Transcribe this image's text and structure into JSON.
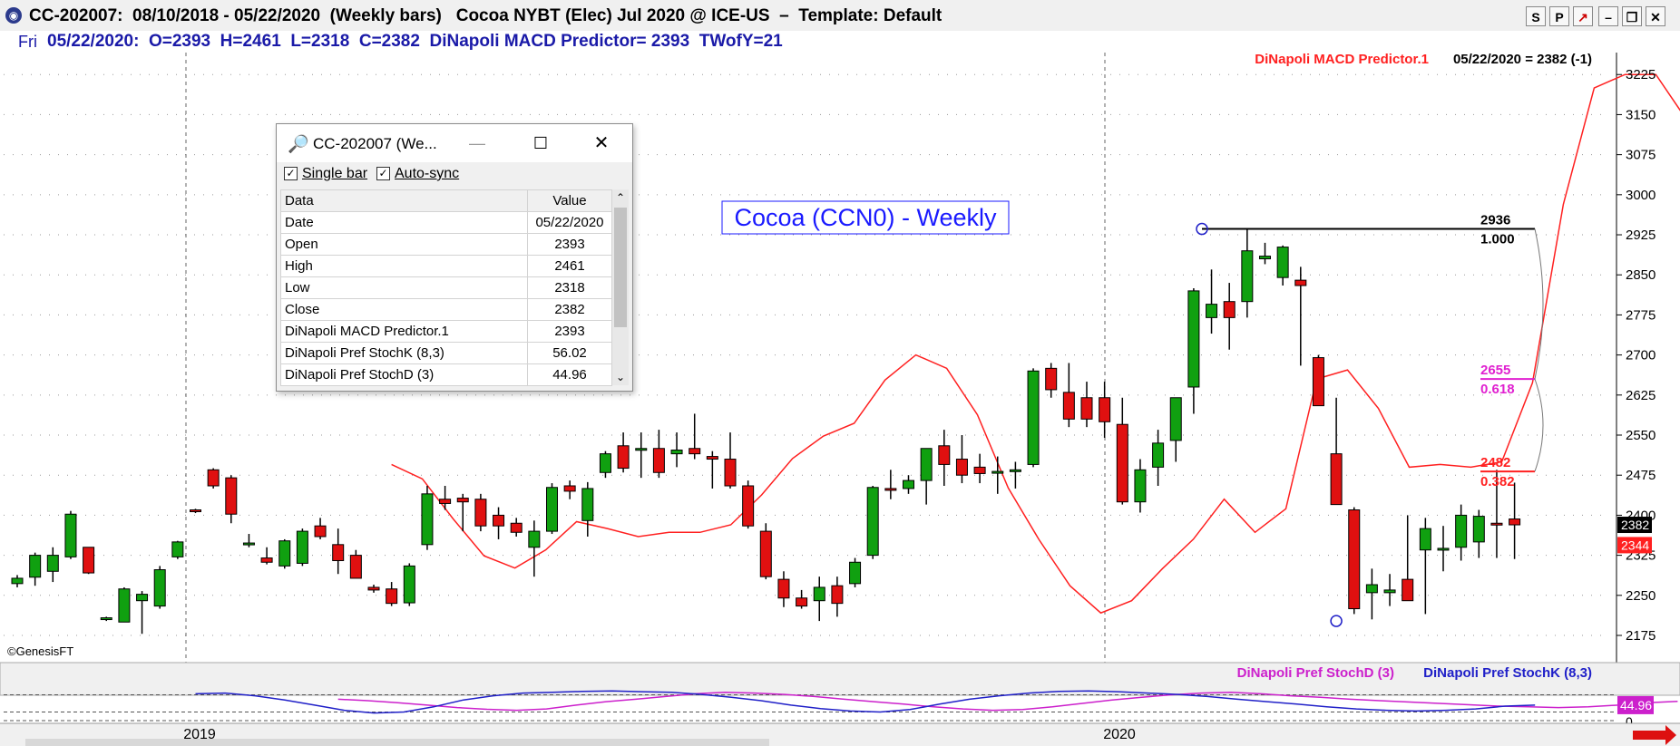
{
  "window": {
    "title": "CC-202007:  08/10/2018 - 05/22/2020  (Weekly bars)   Cocoa NYBT (Elec) Jul 2020 @ ICE-US  –  Template: Default",
    "buttons": [
      "S",
      "P",
      "↗",
      "–",
      "❐",
      "✕"
    ]
  },
  "infobar": {
    "day": "Fri",
    "text": "05/22/2020:  O=2393  H=2461  L=2318  C=2382  DiNapoli MACD Predictor= 2393  TWofY=21"
  },
  "watermark": "©GenesisFT",
  "data_window": {
    "title": "CC-202007 (We...",
    "single_bar_label": "Single bar",
    "auto_sync_label": "Auto-sync",
    "single_bar_checked": true,
    "auto_sync_checked": true,
    "header": [
      "Data",
      "Value"
    ],
    "rows": [
      [
        "Date",
        "05/22/2020"
      ],
      [
        "Open",
        "2393"
      ],
      [
        "High",
        "2461"
      ],
      [
        "Low",
        "2318"
      ],
      [
        "Close",
        "2382"
      ],
      [
        "DiNapoli MACD Predictor.1",
        "2393"
      ],
      [
        "DiNapoli Pref StochK (8,3)",
        "56.02"
      ],
      [
        "DiNapoli Pref StochD (3)",
        "44.96"
      ]
    ]
  },
  "chart_data": [
    {
      "type": "candlestick",
      "title": "Cocoa (CCN0) - Weekly",
      "indicator_label": "DiNapoli MACD Predictor.1",
      "last_value_label": "05/22/2020 = 2382 (-1)",
      "ylim": [
        2125,
        3270
      ],
      "y_ticks": [
        2175,
        2250,
        2325,
        2400,
        2475,
        2550,
        2625,
        2700,
        2775,
        2850,
        2925,
        3000,
        3075,
        3150,
        3225
      ],
      "x_labels": [
        "2019",
        "2020"
      ],
      "price_tags": [
        {
          "value": 2382,
          "label": "2382",
          "color": "#000000"
        },
        {
          "value": 2344,
          "label": "2344",
          "color": "#ff2020"
        }
      ],
      "candles": [
        [
          2272,
          2288,
          2265,
          2282
        ],
        [
          2284,
          2330,
          2268,
          2325
        ],
        [
          2295,
          2340,
          2275,
          2325
        ],
        [
          2322,
          2408,
          2318,
          2402
        ],
        [
          2340,
          2300,
          2290,
          2292
        ],
        [
          2205,
          2210,
          2202,
          2208
        ],
        [
          2200,
          2265,
          2200,
          2262
        ],
        [
          2240,
          2258,
          2178,
          2252
        ],
        [
          2230,
          2305,
          2225,
          2298
        ],
        [
          2322,
          2352,
          2318,
          2350
        ],
        [
          2410,
          2412,
          2404,
          2408
        ],
        [
          2485,
          2488,
          2450,
          2455
        ],
        [
          2470,
          2475,
          2385,
          2402
        ],
        [
          2345,
          2365,
          2340,
          2348
        ],
        [
          2320,
          2340,
          2308,
          2312
        ],
        [
          2305,
          2355,
          2300,
          2352
        ],
        [
          2310,
          2375,
          2305,
          2370
        ],
        [
          2380,
          2395,
          2355,
          2360
        ],
        [
          2345,
          2375,
          2290,
          2315
        ],
        [
          2325,
          2335,
          2295,
          2282
        ],
        [
          2265,
          2270,
          2255,
          2260
        ],
        [
          2262,
          2275,
          2230,
          2235
        ],
        [
          2236,
          2310,
          2230,
          2305
        ],
        [
          2345,
          2455,
          2335,
          2440
        ],
        [
          2430,
          2455,
          2410,
          2422
        ],
        [
          2432,
          2440,
          2370,
          2425
        ],
        [
          2430,
          2440,
          2370,
          2380
        ],
        [
          2400,
          2415,
          2355,
          2380
        ],
        [
          2385,
          2395,
          2360,
          2368
        ],
        [
          2340,
          2390,
          2285,
          2370
        ],
        [
          2370,
          2460,
          2365,
          2452
        ],
        [
          2455,
          2465,
          2430,
          2445
        ],
        [
          2390,
          2462,
          2360,
          2450
        ],
        [
          2480,
          2520,
          2470,
          2515
        ],
        [
          2530,
          2555,
          2480,
          2488
        ],
        [
          2525,
          2555,
          2470,
          2525
        ],
        [
          2525,
          2560,
          2470,
          2480
        ],
        [
          2515,
          2555,
          2490,
          2522
        ],
        [
          2525,
          2590,
          2505,
          2515
        ],
        [
          2510,
          2520,
          2450,
          2505
        ],
        [
          2505,
          2555,
          2450,
          2455
        ],
        [
          2455,
          2465,
          2375,
          2380
        ],
        [
          2370,
          2385,
          2280,
          2285
        ],
        [
          2280,
          2295,
          2228,
          2245
        ],
        [
          2245,
          2260,
          2225,
          2230
        ],
        [
          2240,
          2285,
          2202,
          2265
        ],
        [
          2268,
          2285,
          2210,
          2235
        ],
        [
          2272,
          2320,
          2265,
          2312
        ],
        [
          2325,
          2455,
          2318,
          2452
        ],
        [
          2450,
          2485,
          2430,
          2448
        ],
        [
          2450,
          2475,
          2440,
          2465
        ],
        [
          2465,
          2525,
          2420,
          2525
        ],
        [
          2530,
          2560,
          2455,
          2495
        ],
        [
          2505,
          2550,
          2460,
          2475
        ],
        [
          2490,
          2515,
          2460,
          2478
        ],
        [
          2480,
          2510,
          2440,
          2482
        ],
        [
          2482,
          2500,
          2450,
          2485
        ],
        [
          2495,
          2675,
          2490,
          2670
        ],
        [
          2675,
          2685,
          2620,
          2635
        ],
        [
          2630,
          2685,
          2565,
          2580
        ],
        [
          2620,
          2650,
          2565,
          2580
        ],
        [
          2620,
          2650,
          2545,
          2575
        ],
        [
          2570,
          2620,
          2420,
          2425
        ],
        [
          2425,
          2505,
          2405,
          2485
        ],
        [
          2490,
          2560,
          2455,
          2535
        ],
        [
          2540,
          2610,
          2500,
          2620
        ],
        [
          2640,
          2825,
          2590,
          2820
        ],
        [
          2770,
          2860,
          2740,
          2795
        ],
        [
          2800,
          2835,
          2710,
          2770
        ],
        [
          2800,
          2935,
          2770,
          2895
        ],
        [
          2880,
          2910,
          2870,
          2885
        ],
        [
          2845,
          2905,
          2830,
          2902
        ],
        [
          2840,
          2865,
          2680,
          2830
        ],
        [
          2695,
          2700,
          2605,
          2605
        ],
        [
          2515,
          2620,
          2420,
          2420
        ],
        [
          2410,
          2415,
          2215,
          2225
        ],
        [
          2255,
          2300,
          2205,
          2270
        ],
        [
          2255,
          2290,
          2230,
          2260
        ],
        [
          2280,
          2400,
          2250,
          2240
        ],
        [
          2335,
          2395,
          2215,
          2375
        ],
        [
          2335,
          2380,
          2295,
          2338
        ],
        [
          2340,
          2420,
          2315,
          2400
        ],
        [
          2350,
          2410,
          2320,
          2398
        ],
        [
          2385,
          2485,
          2320,
          2382
        ],
        [
          2393,
          2461,
          2318,
          2382
        ]
      ],
      "macd_predictor": [
        2495,
        2468,
        2393,
        2324,
        2301,
        2335,
        2388,
        2375,
        2360,
        2368,
        2368,
        2382,
        2438,
        2506,
        2548,
        2572,
        2653,
        2700,
        2675,
        2588,
        2451,
        2354,
        2268,
        2217,
        2240,
        2300,
        2355,
        2430,
        2368,
        2412,
        2655,
        2672,
        2600,
        2490,
        2495,
        2490,
        2500,
        2648,
        2982,
        3200,
        3225,
        3225,
        3140,
        2982,
        2770,
        2582,
        2452,
        2338
      ],
      "retracements": [
        {
          "value": 2936,
          "label": "2936",
          "ratio": "1.000",
          "color": "#000000"
        },
        {
          "value": 2655,
          "label": "2655",
          "ratio": "0.618",
          "color": "#e020d0"
        },
        {
          "value": 2482,
          "label": "2482",
          "ratio": "0.382",
          "color": "#ff2020"
        }
      ]
    },
    {
      "type": "line",
      "series": [
        {
          "name": "DiNapoli Pref StochD (3)",
          "color": "#cc20cc",
          "values": [
            62,
            58,
            52,
            45,
            38,
            33,
            30,
            34,
            45,
            55,
            62,
            70,
            78,
            82,
            80,
            76,
            70,
            62,
            55,
            48,
            40,
            34,
            30,
            32,
            40,
            50,
            60,
            68,
            75,
            80,
            82,
            78,
            72,
            68,
            62,
            58,
            54,
            50,
            46,
            42,
            40,
            38,
            40,
            45,
            52,
            56
          ]
        },
        {
          "name": "DiNapoli Pref StochK (8,3)",
          "color": "#2020c8",
          "values": [
            78,
            80,
            72,
            60,
            45,
            30,
            22,
            25,
            40,
            60,
            72,
            80,
            82,
            85,
            86,
            84,
            82,
            76,
            68,
            58,
            45,
            35,
            28,
            25,
            32,
            48,
            62,
            72,
            80,
            85,
            86,
            84,
            80,
            76,
            70,
            62,
            55,
            48,
            40,
            34,
            30,
            28,
            30,
            34,
            42,
            44.96
          ]
        }
      ],
      "ylim": [
        0,
        100
      ],
      "y_ticks": [
        0
      ],
      "value_tag": "44.96"
    }
  ]
}
